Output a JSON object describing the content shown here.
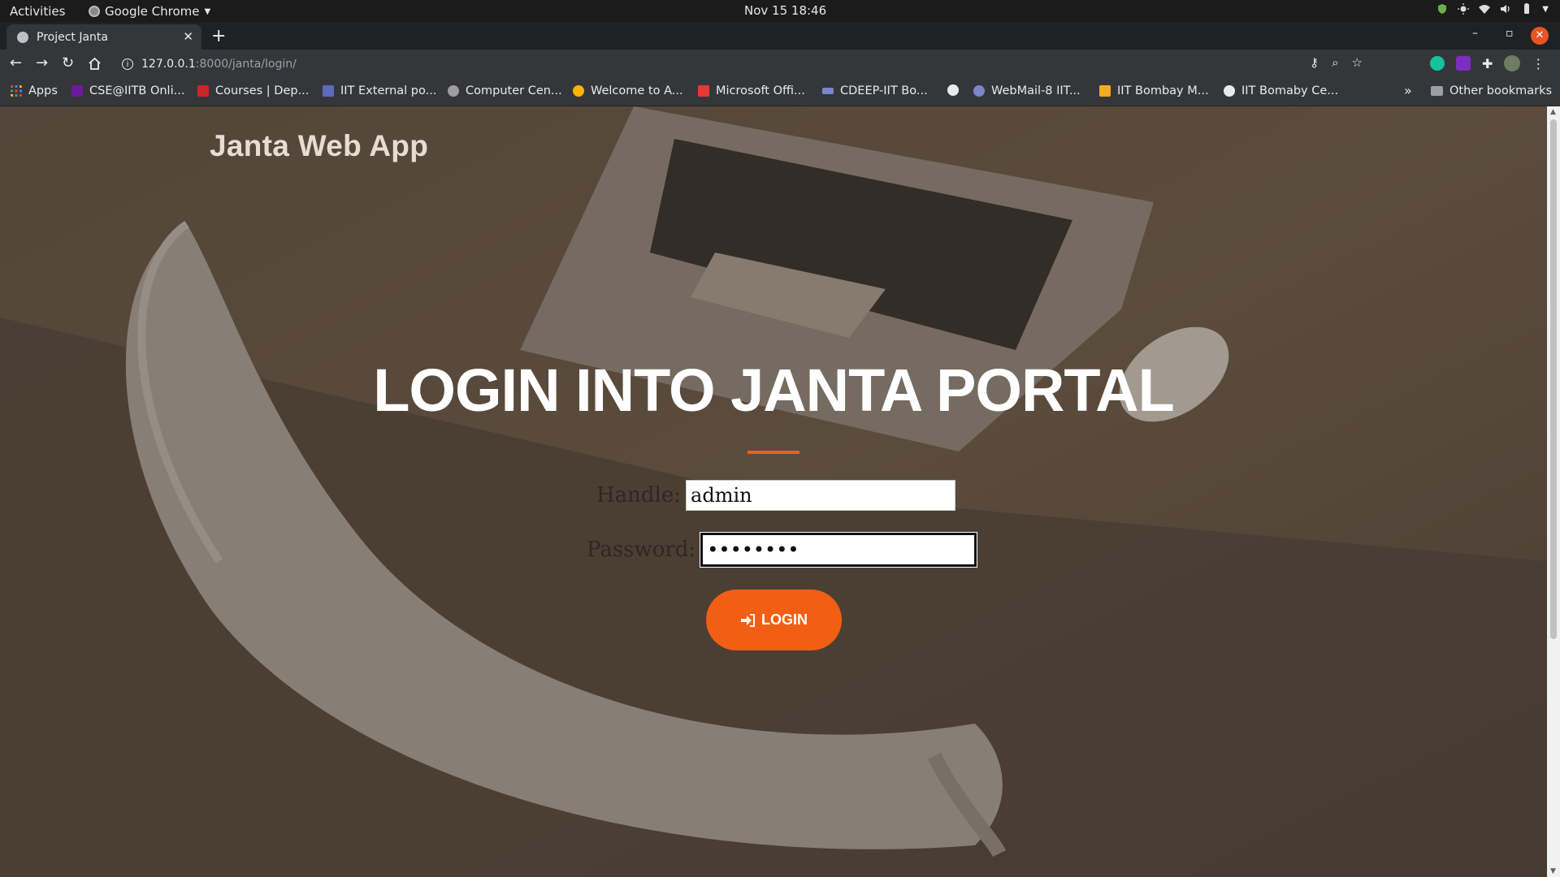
{
  "system_bar": {
    "activities": "Activities",
    "app_name": "Google Chrome",
    "clock": "Nov 15  18:46"
  },
  "browser": {
    "tab_title": "Project Janta",
    "url_host": "127.0.0.1",
    "url_path": ":8000/janta/login/",
    "bookmarks": [
      "Apps",
      "CSE@IITB Onli...",
      "Courses | Dep...",
      "IIT External po...",
      "Computer Cen...",
      "Welcome to A...",
      "Microsoft Offi...",
      "CDEEP-IIT Bo...",
      "WebMail-8 IIT...",
      "IIT Bombay M...",
      "IIT Bomaby Ce..."
    ],
    "other_bookmarks": "Other bookmarks"
  },
  "page": {
    "brand": "Janta Web App",
    "heading": "LOGIN INTO JANTA PORTAL",
    "handle_label": "Handle:",
    "handle_value": "admin",
    "password_label": "Password:",
    "password_value": "••••••••",
    "login_button": "LOGIN"
  },
  "colors": {
    "accent": "#f05f14",
    "overlay": "#51453a"
  }
}
